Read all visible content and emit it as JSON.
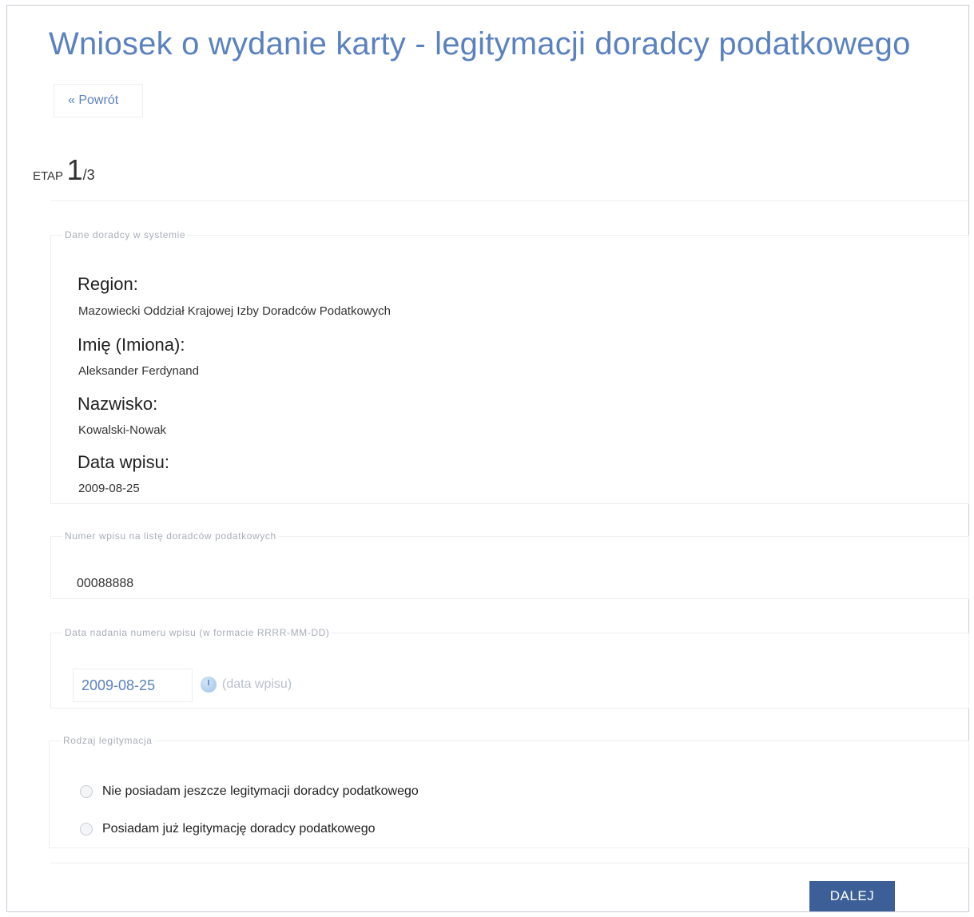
{
  "header": {
    "title": "Wniosek o wydanie karty - legitymacji doradcy podatkowego",
    "back_label": "« Powrót"
  },
  "stage": {
    "label": "ETAP",
    "current": "1",
    "total": "/3"
  },
  "advisor_section": {
    "legend": "Dane doradcy w systemie",
    "region_label": "Region:",
    "region_value": "Mazowiecki Oddział Krajowej Izby Doradców Podatkowych",
    "first_name_label": "Imię (Imiona):",
    "first_name_value": "Aleksander Ferdynand",
    "last_name_label": "Nazwisko:",
    "last_name_value": "Kowalski-Nowak",
    "entry_date_label": "Data wpisu:",
    "entry_date_value": "2009-08-25"
  },
  "entry_number_section": {
    "legend": "Numer wpisu na listę doradców podatkowych",
    "value": "00088888"
  },
  "entry_number_date_section": {
    "legend": "Data nadania numeru wpisu (w formacie RRRR-MM-DD)",
    "value": "2009-08-25",
    "hint": "(data wpisu)"
  },
  "card_type_section": {
    "legend": "Rodzaj legitymacja",
    "options": [
      {
        "label": "Nie posiadam jeszcze legitymacji doradcy podatkowego"
      },
      {
        "label": "Posiadam już legitymację doradcy podatkowego"
      }
    ]
  },
  "footer": {
    "next_label": "DALEJ"
  },
  "colors": {
    "accent": "#5b82c0",
    "button_bg": "#3d5f98",
    "border": "#eceef2"
  },
  "icons": {
    "calendar": "calendar-icon"
  }
}
